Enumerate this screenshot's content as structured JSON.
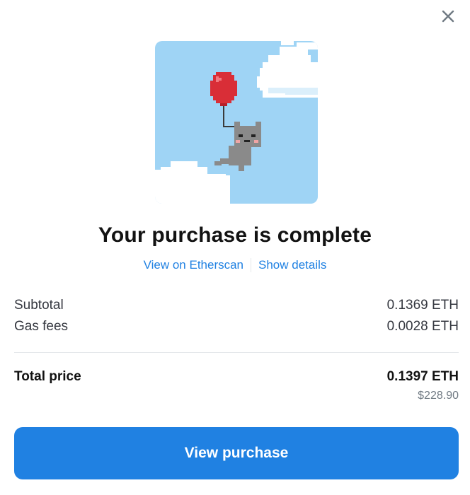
{
  "modal": {
    "title": "Your purchase is complete",
    "close_icon": "close-icon",
    "nft_image": "balloon-cat-pixel-art",
    "links": {
      "etherscan": "View on Etherscan",
      "details": "Show details"
    },
    "summary": {
      "subtotal_label": "Subtotal",
      "subtotal_value": "0.1369 ETH",
      "gas_label": "Gas fees",
      "gas_value": "0.0028 ETH",
      "total_label": "Total price",
      "total_value": "0.1397 ETH",
      "total_usd": "$228.90"
    },
    "cta_label": "View purchase"
  },
  "colors": {
    "accent": "#2081e2",
    "sky": "#9fd4f5",
    "balloon": "#e0313a",
    "cat": "#8a8a8a"
  }
}
